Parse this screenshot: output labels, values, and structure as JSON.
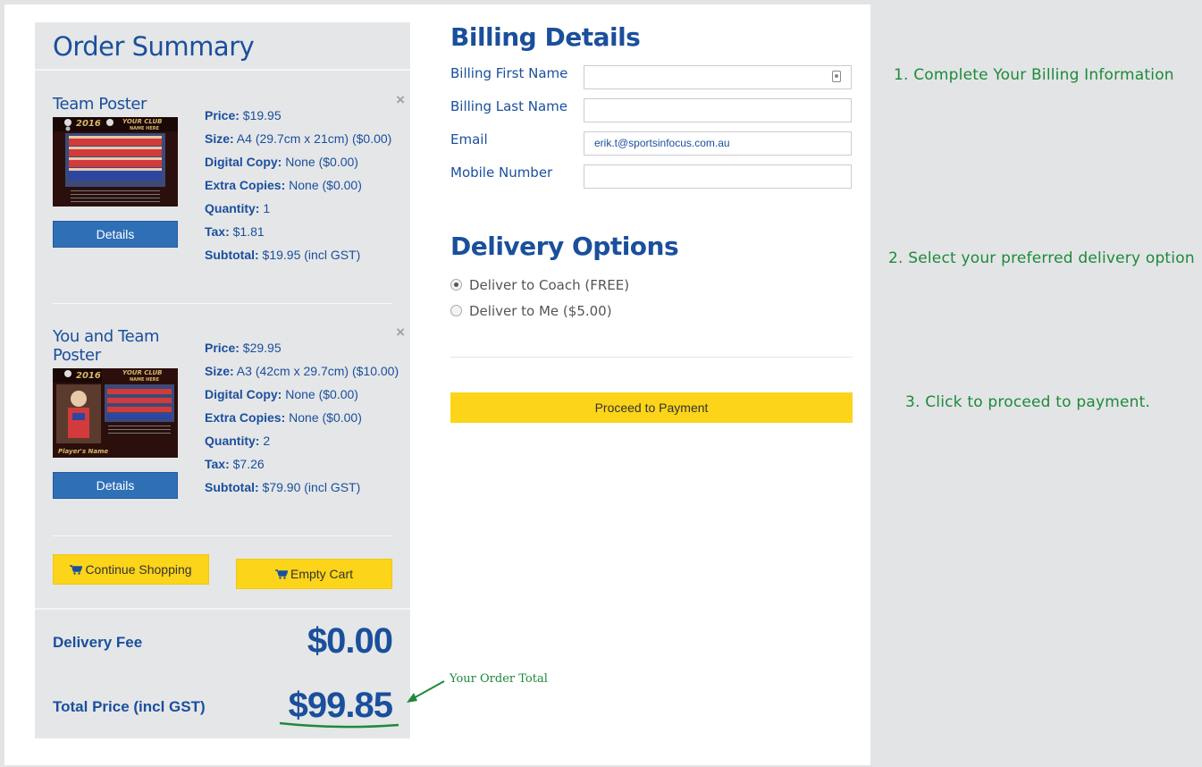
{
  "order_summary": {
    "title": "Order Summary",
    "items": [
      {
        "name": "Team Poster",
        "thumb_banner": "2016",
        "thumb_club": "YOUR CLUB",
        "thumb_sub": "NAME HERE",
        "details_label": "Details",
        "specs": [
          {
            "label": "Price:",
            "value": " $19.95"
          },
          {
            "label": "Size:",
            "value": " A4 (29.7cm x 21cm) ($0.00)"
          },
          {
            "label": "Digital Copy:",
            "value": " None ($0.00)"
          },
          {
            "label": "Extra Copies:",
            "value": " None ($0.00)"
          },
          {
            "label": "Quantity:",
            "value": " 1"
          },
          {
            "label": "Tax:",
            "value": " $1.81"
          },
          {
            "label": "Subtotal:",
            "value": " $19.95 (incl GST)"
          }
        ]
      },
      {
        "name": "You and Team Poster",
        "thumb_banner": "2016",
        "thumb_club": "YOUR CLUB",
        "thumb_sub": "NAME HERE",
        "thumb_player": "Player's Name",
        "details_label": "Details",
        "specs": [
          {
            "label": "Price:",
            "value": " $29.95"
          },
          {
            "label": "Size:",
            "value": " A3 (42cm x 29.7cm) ($10.00)"
          },
          {
            "label": "Digital Copy:",
            "value": " None ($0.00)"
          },
          {
            "label": "Extra Copies:",
            "value": " None ($0.00)"
          },
          {
            "label": "Quantity:",
            "value": " 2"
          },
          {
            "label": "Tax:",
            "value": " $7.26"
          },
          {
            "label": "Subtotal:",
            "value": " $79.90 (incl GST)"
          }
        ]
      }
    ],
    "remove_glyph": "×",
    "continue_label": "Continue Shopping",
    "empty_label": "Empty Cart",
    "delivery_fee_label": "Delivery Fee",
    "delivery_fee_value": "$0.00",
    "total_label": "Total Price (incl GST)",
    "total_value": "$99.85"
  },
  "billing": {
    "title": "Billing Details",
    "fields": [
      {
        "label": "Billing First Name",
        "value": ""
      },
      {
        "label": "Billing Last Name",
        "value": ""
      },
      {
        "label": "Email",
        "value": "erik.t@sportsinfocus.com.au"
      },
      {
        "label": "Mobile Number",
        "value": ""
      }
    ]
  },
  "delivery": {
    "title": "Delivery Options",
    "options": [
      {
        "label": "Deliver to Coach (FREE)",
        "selected": true
      },
      {
        "label": "Deliver to Me ($5.00)",
        "selected": false
      }
    ],
    "proceed_label": "Proceed to Payment"
  },
  "annotations": {
    "step1": "1. Complete Your Billing Information",
    "step2": "2. Select your preferred delivery option",
    "step3": "3. Click to proceed to payment.",
    "total_note": "Your Order Total"
  },
  "colors": {
    "primary": "#1a4f9c",
    "accent_yellow": "#fcd419",
    "annotation_green": "#1d8a3a",
    "details_blue": "#2f6fb6"
  }
}
